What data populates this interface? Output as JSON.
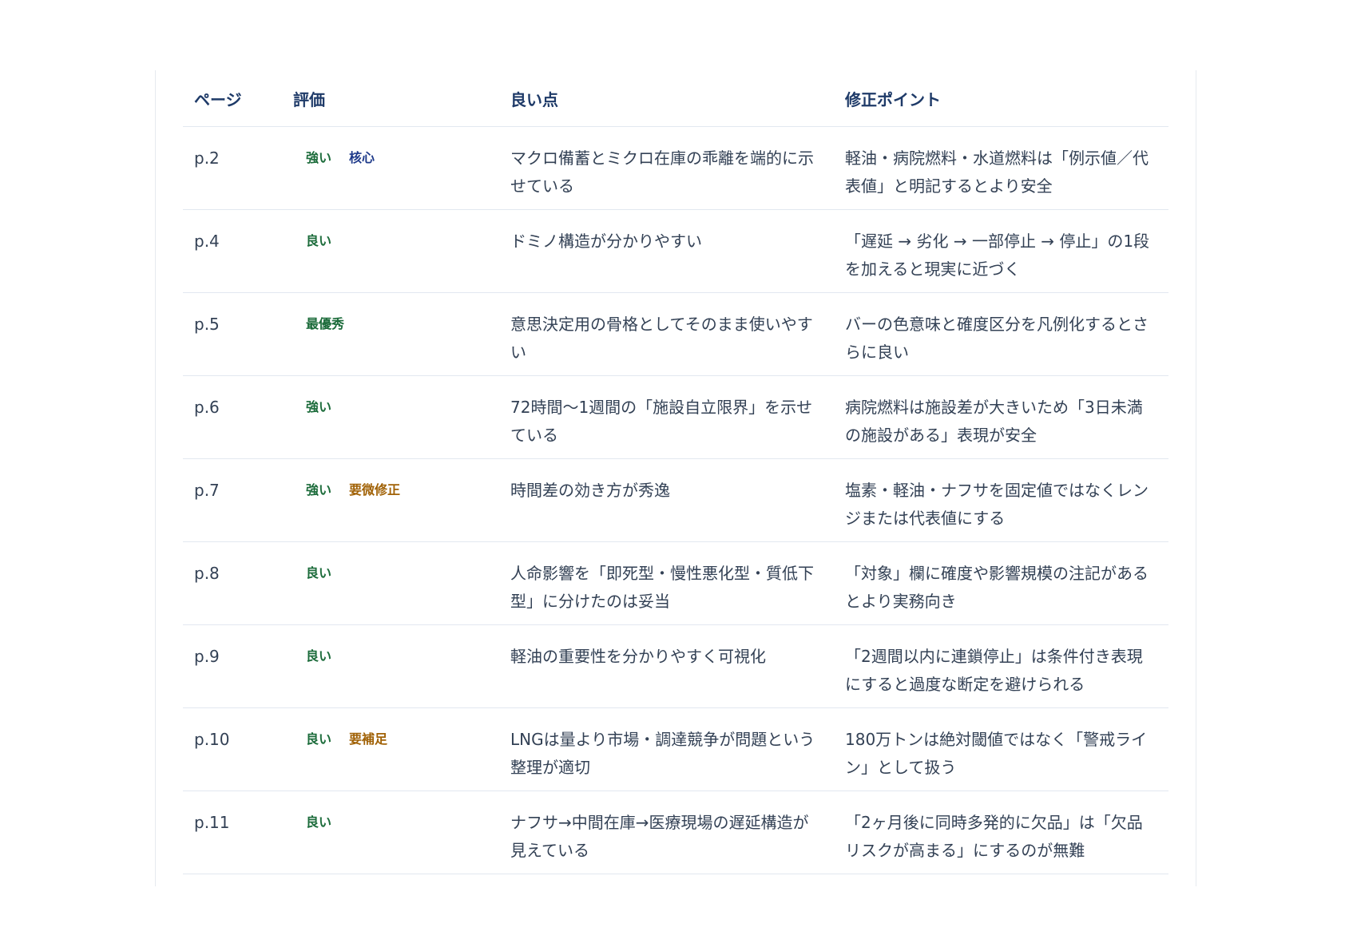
{
  "table": {
    "headers": {
      "page": "ページ",
      "rating": "評価",
      "good": "良い点",
      "fix": "修正ポイント"
    },
    "colors": {
      "header_text": "#1e3a68",
      "badge_green": "#1b6b3a",
      "badge_blue": "#1e3a8a",
      "badge_amber": "#a16207",
      "row_border": "#e2e8f0"
    },
    "rows": [
      {
        "page": "p.2",
        "badges": [
          {
            "label": "強い",
            "tone": "green"
          },
          {
            "label": "核心",
            "tone": "blue"
          }
        ],
        "good": "マクロ備蓄とミクロ在庫の乖離を端的に示せている",
        "fix": "軽油・病院燃料・水道燃料は「例示値／代表値」と明記するとより安全"
      },
      {
        "page": "p.4",
        "badges": [
          {
            "label": "良い",
            "tone": "green"
          }
        ],
        "good": "ドミノ構造が分かりやすい",
        "fix": "「遅延 → 劣化 → 一部停止 → 停止」の1段を加えると現実に近づく"
      },
      {
        "page": "p.5",
        "badges": [
          {
            "label": "最優秀",
            "tone": "green"
          }
        ],
        "good": "意思決定用の骨格としてそのまま使いやすい",
        "fix": "バーの色意味と確度区分を凡例化するとさらに良い"
      },
      {
        "page": "p.6",
        "badges": [
          {
            "label": "強い",
            "tone": "green"
          }
        ],
        "good": "72時間〜1週間の「施設自立限界」を示せている",
        "fix": "病院燃料は施設差が大きいため「3日未満の施設がある」表現が安全"
      },
      {
        "page": "p.7",
        "badges": [
          {
            "label": "強い",
            "tone": "green"
          },
          {
            "label": "要微修正",
            "tone": "amber"
          }
        ],
        "good": "時間差の効き方が秀逸",
        "fix": "塩素・軽油・ナフサを固定値ではなくレンジまたは代表値にする"
      },
      {
        "page": "p.8",
        "badges": [
          {
            "label": "良い",
            "tone": "green"
          }
        ],
        "good": "人命影響を「即死型・慢性悪化型・質低下型」に分けたのは妥当",
        "fix": "「対象」欄に確度や影響規模の注記があるとより実務向き"
      },
      {
        "page": "p.9",
        "badges": [
          {
            "label": "良い",
            "tone": "green"
          }
        ],
        "good": "軽油の重要性を分かりやすく可視化",
        "fix": "「2週間以内に連鎖停止」は条件付き表現にすると過度な断定を避けられる"
      },
      {
        "page": "p.10",
        "badges": [
          {
            "label": "良い",
            "tone": "green"
          },
          {
            "label": "要補足",
            "tone": "amber"
          }
        ],
        "good": "LNGは量より市場・調達競争が問題という整理が適切",
        "fix": "180万トンは絶対閾値ではなく「警戒ライン」として扱う"
      },
      {
        "page": "p.11",
        "badges": [
          {
            "label": "良い",
            "tone": "green"
          }
        ],
        "good": "ナフサ→中間在庫→医療現場の遅延構造が見えている",
        "fix": "「2ヶ月後に同時多発的に欠品」は「欠品リスクが高まる」にするのが無難"
      }
    ]
  }
}
